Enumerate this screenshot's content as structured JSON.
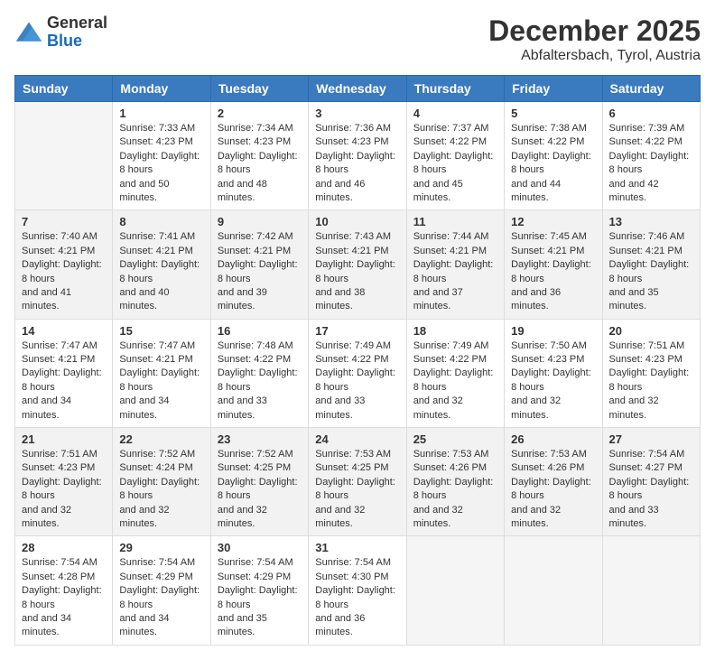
{
  "logo": {
    "general": "General",
    "blue": "Blue"
  },
  "header": {
    "month_year": "December 2025",
    "location": "Abfaltersbach, Tyrol, Austria"
  },
  "weekdays": [
    "Sunday",
    "Monday",
    "Tuesday",
    "Wednesday",
    "Thursday",
    "Friday",
    "Saturday"
  ],
  "weeks": [
    [
      {
        "day": "",
        "sunrise": "",
        "sunset": "",
        "daylight": ""
      },
      {
        "day": "1",
        "sunrise": "Sunrise: 7:33 AM",
        "sunset": "Sunset: 4:23 PM",
        "daylight": "Daylight: 8 hours and 50 minutes."
      },
      {
        "day": "2",
        "sunrise": "Sunrise: 7:34 AM",
        "sunset": "Sunset: 4:23 PM",
        "daylight": "Daylight: 8 hours and 48 minutes."
      },
      {
        "day": "3",
        "sunrise": "Sunrise: 7:36 AM",
        "sunset": "Sunset: 4:23 PM",
        "daylight": "Daylight: 8 hours and 46 minutes."
      },
      {
        "day": "4",
        "sunrise": "Sunrise: 7:37 AM",
        "sunset": "Sunset: 4:22 PM",
        "daylight": "Daylight: 8 hours and 45 minutes."
      },
      {
        "day": "5",
        "sunrise": "Sunrise: 7:38 AM",
        "sunset": "Sunset: 4:22 PM",
        "daylight": "Daylight: 8 hours and 44 minutes."
      },
      {
        "day": "6",
        "sunrise": "Sunrise: 7:39 AM",
        "sunset": "Sunset: 4:22 PM",
        "daylight": "Daylight: 8 hours and 42 minutes."
      }
    ],
    [
      {
        "day": "7",
        "sunrise": "Sunrise: 7:40 AM",
        "sunset": "Sunset: 4:21 PM",
        "daylight": "Daylight: 8 hours and 41 minutes."
      },
      {
        "day": "8",
        "sunrise": "Sunrise: 7:41 AM",
        "sunset": "Sunset: 4:21 PM",
        "daylight": "Daylight: 8 hours and 40 minutes."
      },
      {
        "day": "9",
        "sunrise": "Sunrise: 7:42 AM",
        "sunset": "Sunset: 4:21 PM",
        "daylight": "Daylight: 8 hours and 39 minutes."
      },
      {
        "day": "10",
        "sunrise": "Sunrise: 7:43 AM",
        "sunset": "Sunset: 4:21 PM",
        "daylight": "Daylight: 8 hours and 38 minutes."
      },
      {
        "day": "11",
        "sunrise": "Sunrise: 7:44 AM",
        "sunset": "Sunset: 4:21 PM",
        "daylight": "Daylight: 8 hours and 37 minutes."
      },
      {
        "day": "12",
        "sunrise": "Sunrise: 7:45 AM",
        "sunset": "Sunset: 4:21 PM",
        "daylight": "Daylight: 8 hours and 36 minutes."
      },
      {
        "day": "13",
        "sunrise": "Sunrise: 7:46 AM",
        "sunset": "Sunset: 4:21 PM",
        "daylight": "Daylight: 8 hours and 35 minutes."
      }
    ],
    [
      {
        "day": "14",
        "sunrise": "Sunrise: 7:47 AM",
        "sunset": "Sunset: 4:21 PM",
        "daylight": "Daylight: 8 hours and 34 minutes."
      },
      {
        "day": "15",
        "sunrise": "Sunrise: 7:47 AM",
        "sunset": "Sunset: 4:21 PM",
        "daylight": "Daylight: 8 hours and 34 minutes."
      },
      {
        "day": "16",
        "sunrise": "Sunrise: 7:48 AM",
        "sunset": "Sunset: 4:22 PM",
        "daylight": "Daylight: 8 hours and 33 minutes."
      },
      {
        "day": "17",
        "sunrise": "Sunrise: 7:49 AM",
        "sunset": "Sunset: 4:22 PM",
        "daylight": "Daylight: 8 hours and 33 minutes."
      },
      {
        "day": "18",
        "sunrise": "Sunrise: 7:49 AM",
        "sunset": "Sunset: 4:22 PM",
        "daylight": "Daylight: 8 hours and 32 minutes."
      },
      {
        "day": "19",
        "sunrise": "Sunrise: 7:50 AM",
        "sunset": "Sunset: 4:23 PM",
        "daylight": "Daylight: 8 hours and 32 minutes."
      },
      {
        "day": "20",
        "sunrise": "Sunrise: 7:51 AM",
        "sunset": "Sunset: 4:23 PM",
        "daylight": "Daylight: 8 hours and 32 minutes."
      }
    ],
    [
      {
        "day": "21",
        "sunrise": "Sunrise: 7:51 AM",
        "sunset": "Sunset: 4:23 PM",
        "daylight": "Daylight: 8 hours and 32 minutes."
      },
      {
        "day": "22",
        "sunrise": "Sunrise: 7:52 AM",
        "sunset": "Sunset: 4:24 PM",
        "daylight": "Daylight: 8 hours and 32 minutes."
      },
      {
        "day": "23",
        "sunrise": "Sunrise: 7:52 AM",
        "sunset": "Sunset: 4:25 PM",
        "daylight": "Daylight: 8 hours and 32 minutes."
      },
      {
        "day": "24",
        "sunrise": "Sunrise: 7:53 AM",
        "sunset": "Sunset: 4:25 PM",
        "daylight": "Daylight: 8 hours and 32 minutes."
      },
      {
        "day": "25",
        "sunrise": "Sunrise: 7:53 AM",
        "sunset": "Sunset: 4:26 PM",
        "daylight": "Daylight: 8 hours and 32 minutes."
      },
      {
        "day": "26",
        "sunrise": "Sunrise: 7:53 AM",
        "sunset": "Sunset: 4:26 PM",
        "daylight": "Daylight: 8 hours and 32 minutes."
      },
      {
        "day": "27",
        "sunrise": "Sunrise: 7:54 AM",
        "sunset": "Sunset: 4:27 PM",
        "daylight": "Daylight: 8 hours and 33 minutes."
      }
    ],
    [
      {
        "day": "28",
        "sunrise": "Sunrise: 7:54 AM",
        "sunset": "Sunset: 4:28 PM",
        "daylight": "Daylight: 8 hours and 34 minutes."
      },
      {
        "day": "29",
        "sunrise": "Sunrise: 7:54 AM",
        "sunset": "Sunset: 4:29 PM",
        "daylight": "Daylight: 8 hours and 34 minutes."
      },
      {
        "day": "30",
        "sunrise": "Sunrise: 7:54 AM",
        "sunset": "Sunset: 4:29 PM",
        "daylight": "Daylight: 8 hours and 35 minutes."
      },
      {
        "day": "31",
        "sunrise": "Sunrise: 7:54 AM",
        "sunset": "Sunset: 4:30 PM",
        "daylight": "Daylight: 8 hours and 36 minutes."
      },
      {
        "day": "",
        "sunrise": "",
        "sunset": "",
        "daylight": ""
      },
      {
        "day": "",
        "sunrise": "",
        "sunset": "",
        "daylight": ""
      },
      {
        "day": "",
        "sunrise": "",
        "sunset": "",
        "daylight": ""
      }
    ]
  ]
}
